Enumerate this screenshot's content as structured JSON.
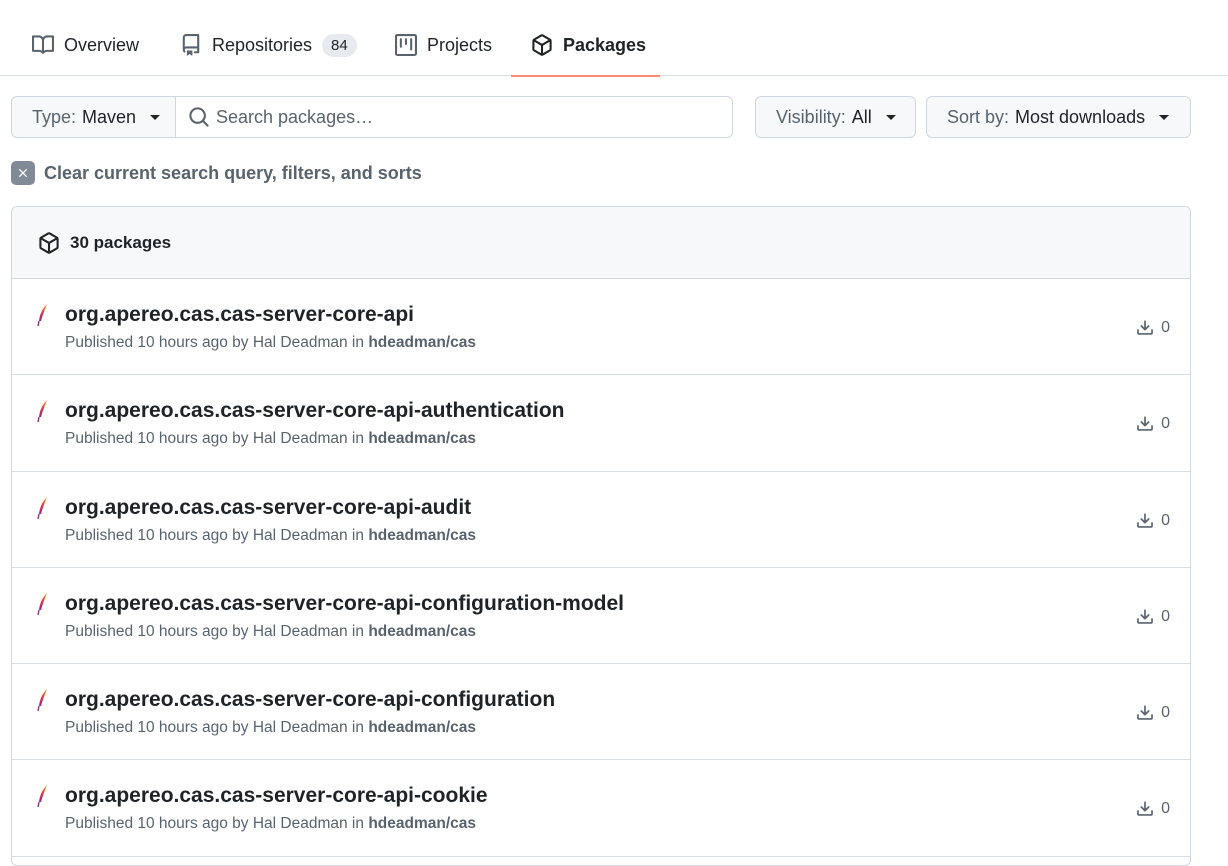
{
  "tabs": {
    "overview": {
      "label": "Overview",
      "icon": "book-icon"
    },
    "repositories": {
      "label": "Repositories",
      "count": "84",
      "icon": "repo-icon"
    },
    "projects": {
      "label": "Projects",
      "icon": "project-icon"
    },
    "packages": {
      "label": "Packages",
      "icon": "package-icon",
      "selected": true
    }
  },
  "filters": {
    "type_prefix": "Type:",
    "type_value": "Maven",
    "search_placeholder": "Search packages…",
    "search_value": "",
    "visibility_prefix": "Visibility:",
    "visibility_value": "All",
    "sort_prefix": "Sort by:",
    "sort_value": "Most downloads"
  },
  "clear_filters_label": "Clear current search query, filters, and sorts",
  "packages_header": {
    "count_label": "30 packages"
  },
  "packages": [
    {
      "name": "org.apereo.cas.cas-server-core-api",
      "published": "Published 10 hours ago by Hal Deadman in",
      "repo": "hdeadman/cas",
      "downloads": "0"
    },
    {
      "name": "org.apereo.cas.cas-server-core-api-authentication",
      "published": "Published 10 hours ago by Hal Deadman in",
      "repo": "hdeadman/cas",
      "downloads": "0"
    },
    {
      "name": "org.apereo.cas.cas-server-core-api-audit",
      "published": "Published 10 hours ago by Hal Deadman in",
      "repo": "hdeadman/cas",
      "downloads": "0"
    },
    {
      "name": "org.apereo.cas.cas-server-core-api-configuration-model",
      "published": "Published 10 hours ago by Hal Deadman in",
      "repo": "hdeadman/cas",
      "downloads": "0"
    },
    {
      "name": "org.apereo.cas.cas-server-core-api-configuration",
      "published": "Published 10 hours ago by Hal Deadman in",
      "repo": "hdeadman/cas",
      "downloads": "0"
    },
    {
      "name": "org.apereo.cas.cas-server-core-api-cookie",
      "published": "Published 10 hours ago by Hal Deadman in",
      "repo": "hdeadman/cas",
      "downloads": "0"
    }
  ],
  "colors": {
    "selected_tab_underline": "#fd8c73",
    "muted_text": "#59636e",
    "border": "#d0d7de",
    "header_bg": "#f6f8fa"
  }
}
